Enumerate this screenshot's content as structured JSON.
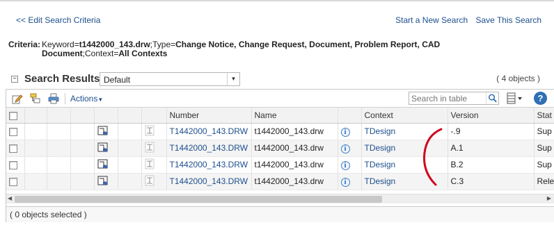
{
  "nav": {
    "back_link": "<< Edit Search Criteria",
    "start_new_search": "Start a New Search",
    "save_search": "Save This Search"
  },
  "criteria": {
    "label": "Criteria:",
    "keyword_label": "Keyword=",
    "keyword_value": "t1442000_143.drw",
    "type_label": ";Type=",
    "type_value_line1": "Change Notice, Change Request, Document, Problem Report, CAD",
    "type_value_line2": "Document",
    "context_label": ";Context=",
    "context_value": "All Contexts"
  },
  "results": {
    "title": "Search Results",
    "view": "Default",
    "object_count": "( 4 objects )"
  },
  "toolbar": {
    "actions_label": "Actions",
    "search_placeholder": "Search in table"
  },
  "table": {
    "columns": [
      "Number",
      "Name",
      "Context",
      "Version",
      "Stat"
    ],
    "rows": [
      {
        "number": "T1442000_143.DRW",
        "name": "t1442000_143.drw",
        "context": "TDesign",
        "version": "-.9",
        "state": "Sup"
      },
      {
        "number": "T1442000_143.DRW",
        "name": "t1442000_143.drw",
        "context": "TDesign",
        "version": "A.1",
        "state": "Sup"
      },
      {
        "number": "T1442000_143.DRW",
        "name": "t1442000_143.drw",
        "context": "TDesign",
        "version": "B.2",
        "state": "Sup"
      },
      {
        "number": "T1442000_143.DRW",
        "name": "t1442000_143.drw",
        "context": "TDesign",
        "version": "C.3",
        "state": "Rele"
      }
    ]
  },
  "footer": {
    "selected_text": "( 0 objects selected )"
  },
  "colors": {
    "link": "#1d4f8c",
    "annotation": "#d0021b",
    "help": "#2f6fb3"
  },
  "icons": [
    "collapse-icon",
    "edit-icon",
    "set-state-icon",
    "print-icon",
    "search-icon",
    "columns-icon",
    "help-icon",
    "info-icon",
    "part-icon",
    "drawing-icon"
  ]
}
